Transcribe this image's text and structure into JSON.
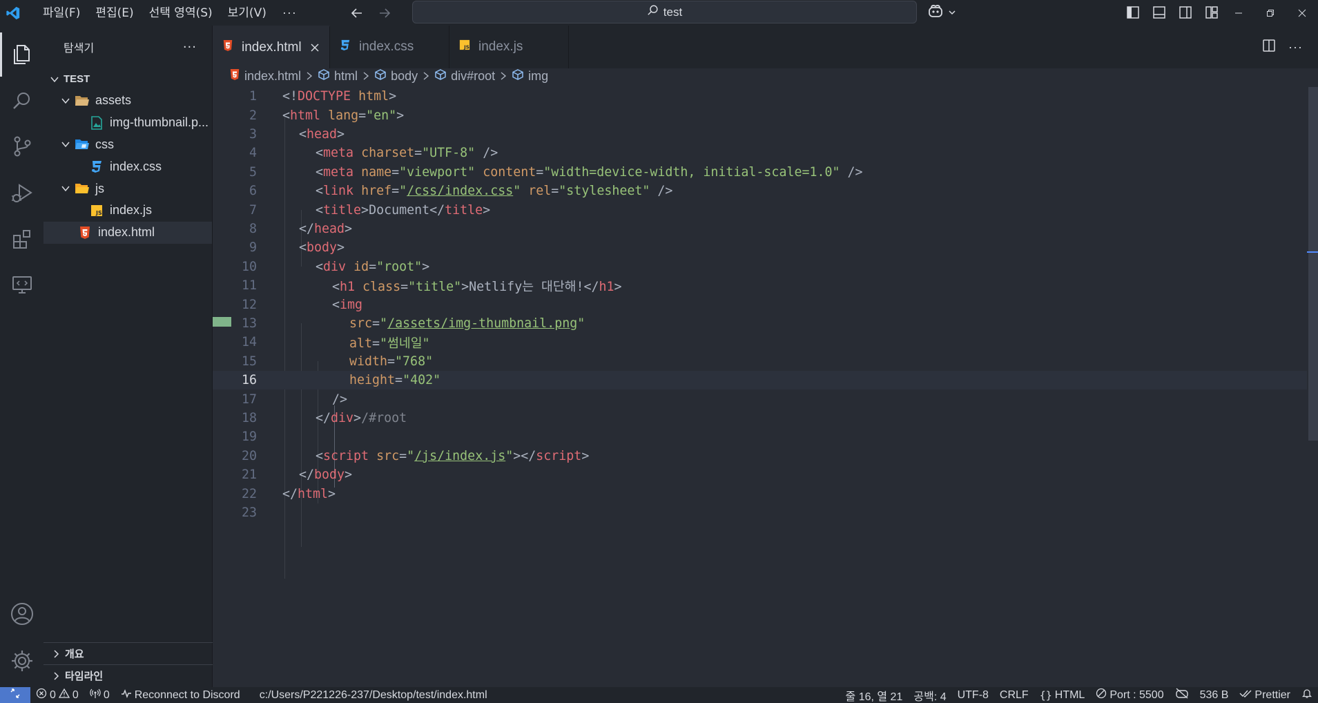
{
  "menu": {
    "items": [
      "파일(F)",
      "편집(E)",
      "선택 영역(S)",
      "보기(V)"
    ],
    "more": "···"
  },
  "search": {
    "text": "test"
  },
  "explorer": {
    "title": "탐색기",
    "more": "···",
    "root": "TEST",
    "tree": [
      {
        "label": "assets",
        "kind": "folder",
        "depth": 1
      },
      {
        "label": "img-thumbnail.p...",
        "kind": "image",
        "depth": 2
      },
      {
        "label": "css",
        "kind": "folder-css",
        "depth": 1
      },
      {
        "label": "index.css",
        "kind": "css",
        "depth": 2
      },
      {
        "label": "js",
        "kind": "folder-js",
        "depth": 1
      },
      {
        "label": "index.js",
        "kind": "js",
        "depth": 2
      },
      {
        "label": "index.html",
        "kind": "html",
        "depth": 1
      }
    ],
    "outline": "개요",
    "timeline": "타임라인"
  },
  "tabs": [
    {
      "label": "index.html",
      "kind": "html",
      "active": true
    },
    {
      "label": "index.css",
      "kind": "css",
      "active": false
    },
    {
      "label": "index.js",
      "kind": "js",
      "active": false
    }
  ],
  "breadcrumb": [
    "index.html",
    "html",
    "body",
    "div#root",
    "img"
  ],
  "editor": {
    "current_line": 16,
    "lines": [
      "1",
      "2",
      "3",
      "4",
      "5",
      "6",
      "7",
      "8",
      "9",
      "10",
      "11",
      "12",
      "13",
      "14",
      "15",
      "16",
      "17",
      "18",
      "19",
      "20",
      "21",
      "22",
      "23"
    ],
    "code": {
      "l1_a": "<!",
      "l1_b": "DOCTYPE",
      "l1_c": " html",
      "l1_d": ">",
      "l2_tag": "html",
      "l2_attr": "lang",
      "l2_val": "\"en\"",
      "l3_tag": "head",
      "l4_tag": "meta",
      "l4_attr": "charset",
      "l4_val": "\"UTF-8\"",
      "l5_tag": "meta",
      "l5_attr1": "name",
      "l5_val1": "\"viewport\"",
      "l5_attr2": "content",
      "l5_val2": "\"width=device-width, initial-scale=1.0\"",
      "l6_tag": "link",
      "l6_attr1": "href",
      "l6_val1": "/css/index.css",
      "l6_attr2": "rel",
      "l6_val2": "\"stylesheet\"",
      "l7_tag": "title",
      "l7_text": "Document",
      "l8_tag": "head",
      "l9_tag": "body",
      "l10_tag": "div",
      "l10_attr": "id",
      "l10_val": "\"root\"",
      "l11_tag": "h1",
      "l11_attr": "class",
      "l11_val": "\"title\"",
      "l11_text": "Netlify는 대단해!",
      "l12_tag": "img",
      "l13_attr": "src",
      "l13_val": "/assets/img-thumbnail.png",
      "l14_attr": "alt",
      "l14_val": "\"썸네일\"",
      "l15_attr": "width",
      "l15_val": "\"768\"",
      "l16_attr": "height",
      "l16_val": "\"402\"",
      "l17": "/>",
      "l18_tag": "div",
      "l18_comment": "/#root",
      "l20_tag": "script",
      "l20_attr": "src",
      "l20_val": "/js/index.js",
      "l21_tag": "body",
      "l22_tag": "html"
    }
  },
  "statusbar": {
    "errors": "0",
    "warnings": "0",
    "ports": "0",
    "discord": "Reconnect to Discord",
    "path": "c:/Users/P221226-237/Desktop/test/index.html",
    "position": "줄 16, 열 21",
    "spaces": "공백: 4",
    "encoding": "UTF-8",
    "eol": "CRLF",
    "language": "HTML",
    "port": "Port : 5500",
    "size": "536 B",
    "prettier": "Prettier"
  },
  "colors": {
    "accent": "#4d78cc",
    "html_icon": "#e44d26",
    "css_icon": "#42a5f5",
    "js_icon": "#fbc02d",
    "folder": "#dcb67a"
  }
}
